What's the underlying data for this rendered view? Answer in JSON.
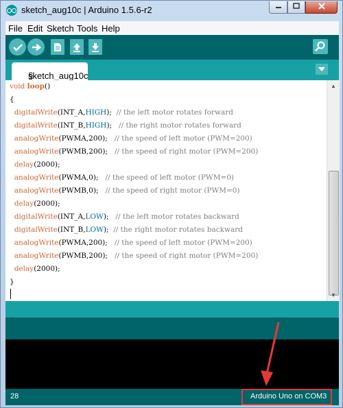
{
  "window": {
    "title": "sketch_aug10c | Arduino 1.5.6-r2"
  },
  "menu": [
    "File",
    "Edit",
    "Sketch",
    "Tools",
    "Help"
  ],
  "tab": {
    "label": "sketch_aug10c",
    "symbol": "§"
  },
  "code": [
    [
      {
        "t": "void ",
        "c": "kw"
      },
      {
        "t": "loop",
        "c": "kw-b"
      },
      {
        "t": "()"
      }
    ],
    [
      {
        "t": "{"
      }
    ],
    [
      {
        "t": "  "
      },
      {
        "t": "digitalWrite",
        "c": "fn"
      },
      {
        "t": "(INT_A,"
      },
      {
        "t": "HIGH",
        "c": "const"
      },
      {
        "t": ");  "
      },
      {
        "t": "// the left motor rotates forward",
        "c": "cmt"
      }
    ],
    [
      {
        "t": "  "
      },
      {
        "t": "digitalWrite",
        "c": "fn"
      },
      {
        "t": "(INT_B,"
      },
      {
        "t": "HIGH",
        "c": "const"
      },
      {
        "t": ");   "
      },
      {
        "t": "// the right motor rotates forward",
        "c": "cmt"
      }
    ],
    [
      {
        "t": "  "
      },
      {
        "t": "analogWrite",
        "c": "fn"
      },
      {
        "t": "(PWMA,200);   "
      },
      {
        "t": "// the speed of left motor (PWM=200)",
        "c": "cmt"
      }
    ],
    [
      {
        "t": "  "
      },
      {
        "t": "analogWrite",
        "c": "fn"
      },
      {
        "t": "(PWMB,200);   "
      },
      {
        "t": "// the speed of right motor (PWM=200)",
        "c": "cmt"
      }
    ],
    [
      {
        "t": "  "
      },
      {
        "t": "delay",
        "c": "fn"
      },
      {
        "t": "(2000);"
      }
    ],
    [
      {
        "t": "  "
      },
      {
        "t": "analogWrite",
        "c": "fn"
      },
      {
        "t": "(PWMA,0);   "
      },
      {
        "t": "// the speed of left motor (PWM=0)",
        "c": "cmt"
      }
    ],
    [
      {
        "t": "  "
      },
      {
        "t": "analogWrite",
        "c": "fn"
      },
      {
        "t": "(PWMB,0);   "
      },
      {
        "t": "// the speed of right motor (PWM=0)",
        "c": "cmt"
      }
    ],
    [
      {
        "t": "  "
      },
      {
        "t": "delay",
        "c": "fn"
      },
      {
        "t": "(2000);"
      }
    ],
    [
      {
        "t": "  "
      },
      {
        "t": "digitalWrite",
        "c": "fn"
      },
      {
        "t": "(INT_A,"
      },
      {
        "t": "LOW",
        "c": "const"
      },
      {
        "t": ");   "
      },
      {
        "t": "// the left motor rotates backward",
        "c": "cmt"
      }
    ],
    [
      {
        "t": "  "
      },
      {
        "t": "digitalWrite",
        "c": "fn"
      },
      {
        "t": "(INT_B,"
      },
      {
        "t": "LOW",
        "c": "const"
      },
      {
        "t": ");  "
      },
      {
        "t": "// the right motor rotates backward",
        "c": "cmt"
      }
    ],
    [
      {
        "t": "  "
      },
      {
        "t": "analogWrite",
        "c": "fn"
      },
      {
        "t": "(PWMA,200);   "
      },
      {
        "t": "// the speed of left motor (PWM=200)",
        "c": "cmt"
      }
    ],
    [
      {
        "t": "  "
      },
      {
        "t": "analogWrite",
        "c": "fn"
      },
      {
        "t": "(PWMB,200);   "
      },
      {
        "t": "// the speed of right motor (PWM=200)",
        "c": "cmt"
      }
    ],
    [
      {
        "t": "  "
      },
      {
        "t": "delay",
        "c": "fn"
      },
      {
        "t": "(2000);"
      }
    ],
    [
      {
        "t": "}"
      }
    ]
  ],
  "status": {
    "line": "28",
    "board": "Arduino Uno on COM3"
  },
  "colors": {
    "toolbar": "#006468",
    "accent": "#17a1a5",
    "button": "#4db7bb",
    "highlight": "#e53935"
  }
}
